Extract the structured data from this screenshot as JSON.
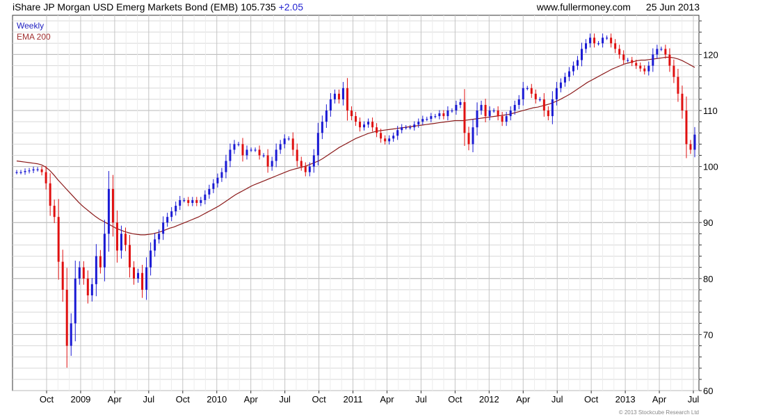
{
  "header": {
    "title": "iShare JP Morgan USD Emerg Markets Bond (EMB) 105.735",
    "change": "+2.05",
    "site": "www.fullermoney.com",
    "date": "25 Jun 2013"
  },
  "legend": {
    "weekly": "Weekly",
    "ema": "EMA 200"
  },
  "copyright": "© 2013 Stockcube Research Ltd",
  "colors": {
    "up": "#1a1ad4",
    "down": "#e01010",
    "ema": "#8b1a1a",
    "grid": "#d8d8d8",
    "frame": "#333333"
  },
  "chart_data": {
    "type": "candlestick",
    "xlabels": [
      "Oct",
      "2009",
      "Apr",
      "Jul",
      "Oct",
      "2010",
      "Apr",
      "Jul",
      "Oct",
      "2011",
      "Apr",
      "Jul",
      "Oct",
      "2012",
      "Apr",
      "Jul",
      "Oct",
      "2013",
      "Apr",
      "Jul"
    ],
    "ylim": [
      60,
      127
    ],
    "yticks": [
      60,
      70,
      80,
      90,
      100,
      110,
      120
    ],
    "legend_position": "top-left",
    "grid": true,
    "series": [
      {
        "name": "Weekly",
        "kind": "close",
        "values": [
          99,
          99,
          99.2,
          99.3,
          99.5,
          99.5,
          99,
          97,
          93,
          91,
          83,
          78,
          68,
          72,
          80,
          82,
          80,
          77,
          79,
          84,
          82,
          88,
          96,
          90,
          85,
          88,
          86,
          82,
          80,
          81,
          78,
          82,
          85,
          87,
          88,
          90,
          91,
          92,
          93,
          94,
          94,
          93.5,
          94,
          93.5,
          94,
          95,
          96,
          97,
          98,
          99,
          101,
          103,
          104,
          104,
          102,
          103,
          103,
          103,
          102,
          102,
          100,
          101,
          103,
          104,
          105,
          105,
          103,
          101,
          100,
          99,
          100,
          102,
          106,
          108,
          110,
          112,
          113,
          112,
          114,
          110,
          109,
          108,
          107,
          107.5,
          108,
          107,
          106,
          105,
          104.5,
          105,
          105.5,
          106.5,
          107,
          107,
          107,
          107.5,
          108,
          108.5,
          108.5,
          109,
          109,
          109.5,
          109,
          110,
          110,
          111,
          111.5,
          106,
          104,
          107,
          110,
          111,
          109,
          110,
          110,
          109,
          108,
          109,
          110,
          111,
          112,
          114,
          114,
          113,
          112,
          112,
          110,
          109,
          112,
          114,
          115,
          116,
          117,
          118,
          119,
          121,
          122,
          123,
          122,
          122,
          123,
          123,
          122,
          121,
          120,
          119,
          119,
          118.5,
          118,
          117.5,
          117,
          118,
          120,
          121,
          121,
          120,
          118,
          116,
          113,
          110,
          104,
          103,
          105.7
        ]
      },
      {
        "name": "EMA 200",
        "kind": "line",
        "values": [
          101,
          100.9,
          100.8,
          100.7,
          100.6,
          100.5,
          100.3,
          99.9,
          99.3,
          98.5,
          97.6,
          96.8,
          96,
          95.2,
          94.4,
          93.6,
          92.9,
          92.3,
          91.7,
          91.1,
          90.6,
          90.2,
          89.8,
          89.4,
          89,
          88.7,
          88.4,
          88.2,
          88,
          87.9,
          87.8,
          87.8,
          87.9,
          88,
          88.2,
          88.4,
          88.7,
          89,
          89.2,
          89.5,
          89.8,
          90.1,
          90.4,
          90.7,
          91,
          91.4,
          91.8,
          92.2,
          92.6,
          93,
          93.5,
          94,
          94.5,
          95,
          95.4,
          95.8,
          96.2,
          96.6,
          96.9,
          97.2,
          97.5,
          97.8,
          98.1,
          98.4,
          98.7,
          99,
          99.3,
          99.5,
          99.7,
          99.9,
          100.1,
          100.4,
          100.7,
          101,
          101.4,
          101.9,
          102.4,
          102.9,
          103.4,
          103.8,
          104.2,
          104.6,
          105,
          105.3,
          105.6,
          105.9,
          106.1,
          106.3,
          106.4,
          106.5,
          106.6,
          106.7,
          106.8,
          106.9,
          107,
          107.1,
          107.2,
          107.3,
          107.4,
          107.5,
          107.6,
          107.7,
          107.8,
          107.9,
          108,
          108.1,
          108.2,
          108.2,
          108.2,
          108.3,
          108.4,
          108.5,
          108.6,
          108.7,
          108.8,
          108.9,
          109,
          109.1,
          109.2,
          109.3,
          109.5,
          109.7,
          109.9,
          110.1,
          110.3,
          110.5,
          110.6,
          110.8,
          111,
          111.2,
          111.5,
          111.8,
          112.2,
          112.6,
          113,
          113.5,
          114,
          114.5,
          115,
          115.4,
          115.8,
          116.2,
          116.6,
          117,
          117.4,
          117.7,
          118,
          118.3,
          118.5,
          118.7,
          118.9,
          119,
          119,
          119.1,
          119.2,
          119.3,
          119.4,
          119.5,
          119.5,
          119.4,
          119.2,
          118.9,
          118.5,
          118.1,
          117.7
        ]
      }
    ]
  }
}
